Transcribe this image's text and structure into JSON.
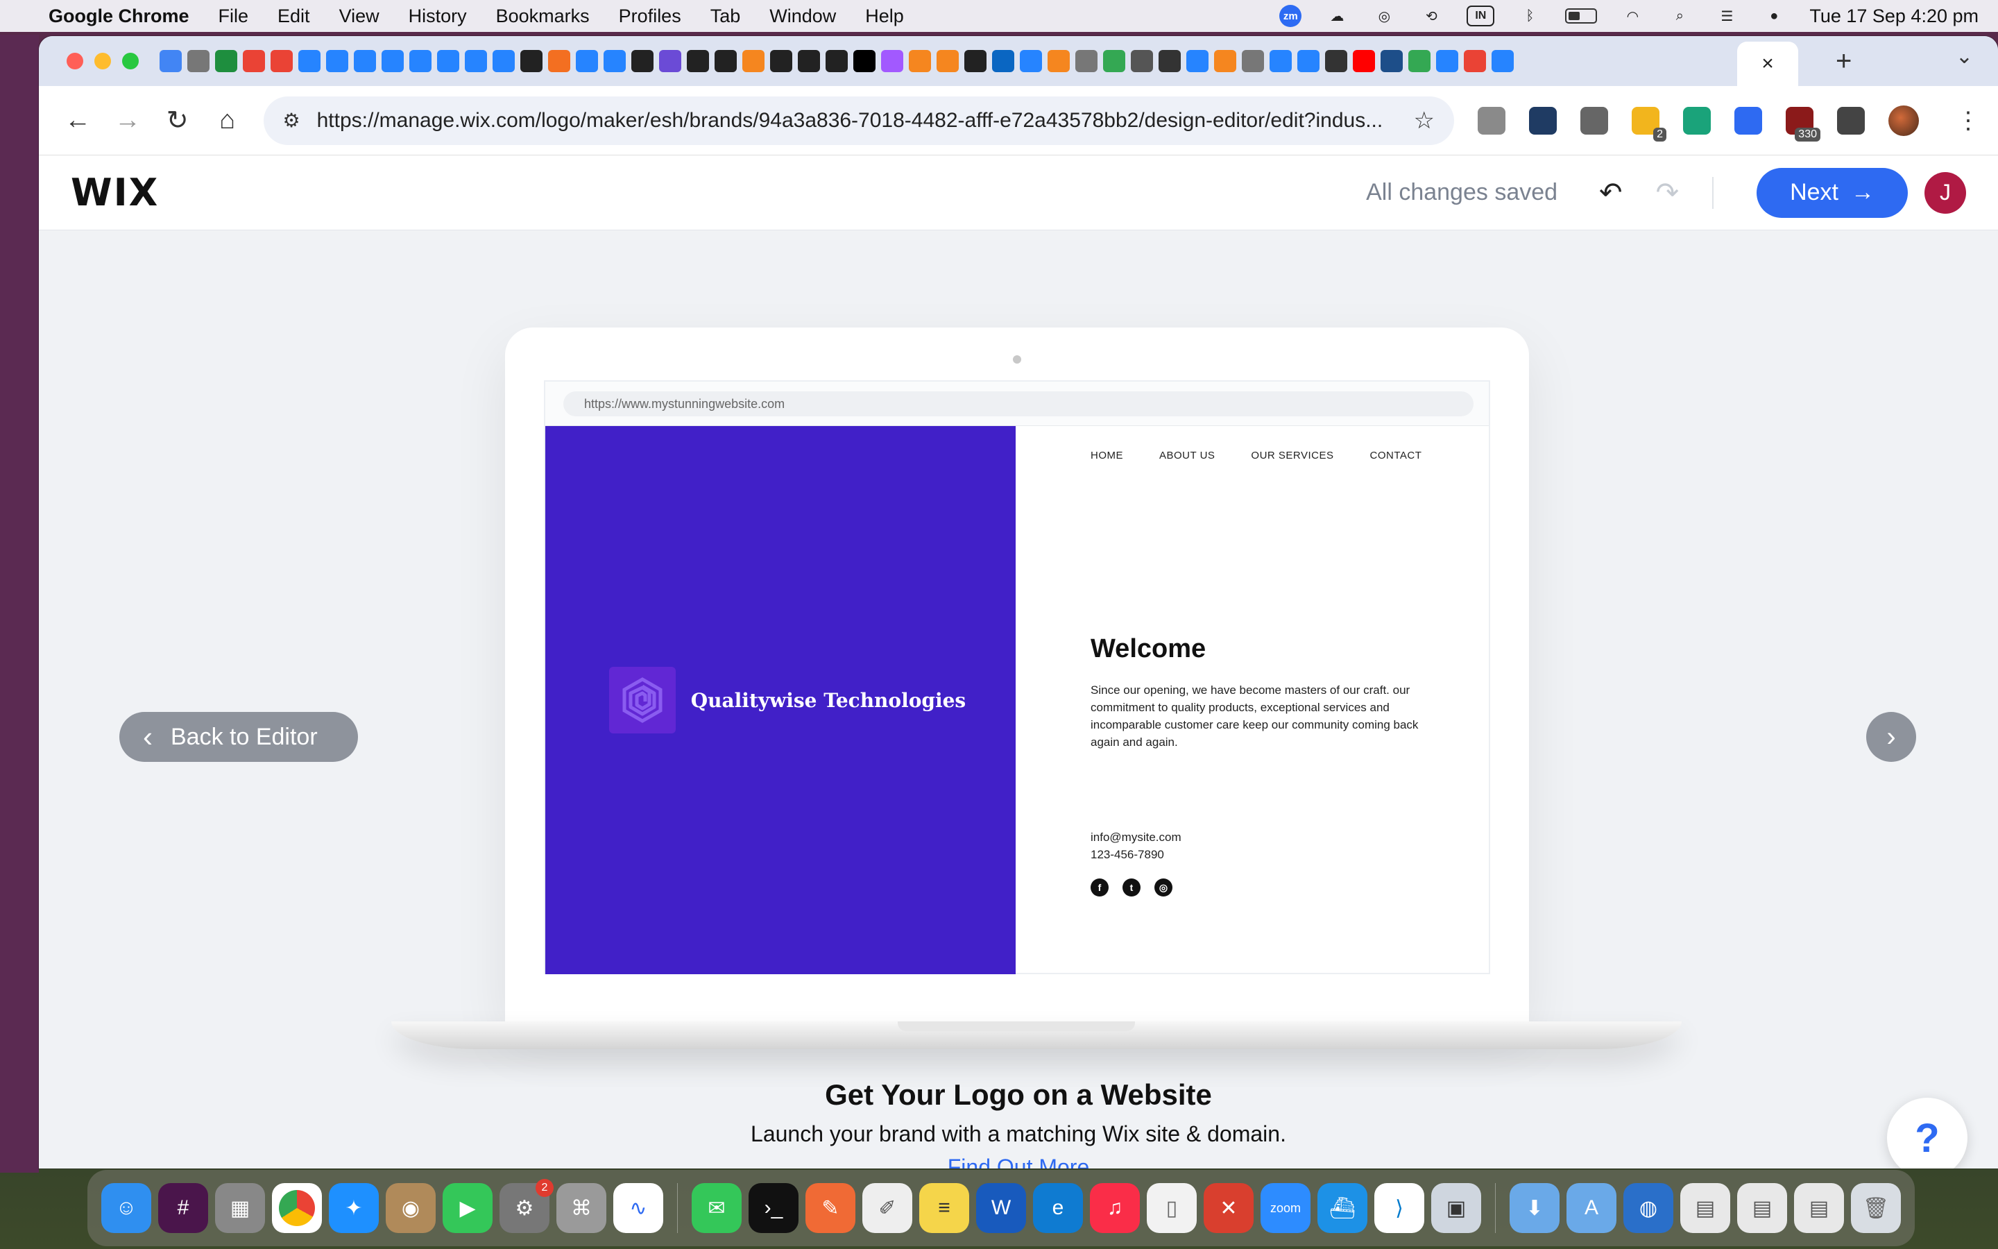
{
  "menubar": {
    "app_name": "Google Chrome",
    "items": [
      "File",
      "Edit",
      "View",
      "History",
      "Bookmarks",
      "Profiles",
      "Tab",
      "Window",
      "Help"
    ],
    "zoom_label": "zm",
    "input_label": "IN",
    "clock": "Tue 17 Sep  4:20 pm"
  },
  "browser": {
    "url": "https://manage.wix.com/logo/maker/esh/brands/94a3a836-7018-4482-afff-e72a43578bb2/design-editor/edit?indus...",
    "close_tab": "×",
    "new_tab": "+",
    "extension_badges": {
      "calendar": "2",
      "mail": "330"
    }
  },
  "wix": {
    "logo": "WIX",
    "saved_status": "All changes saved",
    "next_label": "Next",
    "avatar_initial": "J",
    "back_label": "Back to Editor"
  },
  "mockup": {
    "url": "https://www.mystunningwebsite.com",
    "brand_name": "Qualitywise Technologies",
    "nav": [
      "HOME",
      "ABOUT US",
      "OUR SERVICES",
      "CONTACT"
    ],
    "welcome": "Welcome",
    "paragraph": "Since our opening, we have become masters of our craft. our commitment to quality products, exceptional services and incomparable customer care keep our community coming back again and again.",
    "email": "info@mysite.com",
    "phone": "123-456-7890",
    "brand_color": "#4120c8"
  },
  "promo": {
    "title": "Get Your Logo on a Website",
    "subtitle": "Launch your brand with a matching Wix site & domain.",
    "link": "Find Out More"
  },
  "help_label": "?",
  "dock": {
    "settings_badge": "2",
    "zoom_label": "zoom"
  },
  "colors": {
    "accent": "#2e6af2",
    "avatar": "#b01a44",
    "logo_mark": "#6127d4"
  }
}
